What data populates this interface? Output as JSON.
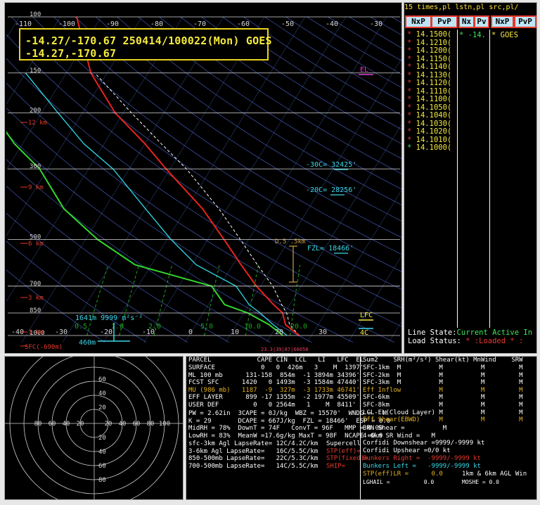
{
  "colors": {
    "temp": "#e8231e",
    "dewpoint": "#33d62d",
    "wetbulb": "#2ed8e8",
    "parcel": "#ffffff",
    "isobar": "#ffffff",
    "isotherm": "#4e6fc9",
    "mixratio": "#1aa41a",
    "dryadiabat": "#4459b8",
    "label_cyan": "#3ad8e8",
    "label_red": "#e23a2a",
    "label_yellow": "#f4ea3c",
    "label_magenta": "#e03ae0"
  },
  "location": {
    "line1": "-14.27/-170.67 250414/100022(Mon) GOES",
    "line2": "-14.27,-170.67"
  },
  "chart_data": {
    "type": "line",
    "title": "",
    "x_tick_labels_top": [
      "-110",
      "-100",
      "-90",
      "-80",
      "-70",
      "-60",
      "-50",
      "-40",
      "-30"
    ],
    "x_tick_labels_bottom": [
      "-40",
      "-30",
      "-20",
      "-10",
      "0",
      "10",
      "20",
      "30"
    ],
    "pressure_levels": [
      "100",
      "150",
      "200",
      "300",
      "500",
      "700",
      "850",
      "1000"
    ],
    "height_labels": [
      "12 km",
      "9 km",
      "6 km",
      "3 km",
      "1 km"
    ],
    "sfc_label": "SFC(-690m)",
    "mixing_ratio_labels": [
      "0.5",
      "1.0",
      "2.0",
      "5.0",
      "10.0",
      "20.0"
    ],
    "annotations": {
      "el": "EL",
      "m30c": "-30C= 32425'",
      "m20c": "-20C= 28256'",
      "fzl": "FZL= 18466'",
      "lfc": "LFC",
      "lcl": "4C",
      "storm": "1641m 9999 m²s⁻²",
      "hgt460": "460m",
      "ds": "D.5 .5km",
      "footer": "23.3|39|87|66058"
    },
    "temperature": {
      "pressure": [
        1000,
        925,
        850,
        800,
        700,
        600,
        500,
        400,
        300,
        250,
        200,
        150,
        100
      ],
      "value": [
        27,
        22,
        19.5,
        16,
        9,
        2,
        -6,
        -16,
        -31,
        -40,
        -52,
        -64,
        -76
      ]
    },
    "dewpoint": {
      "pressure": [
        1000,
        925,
        850,
        800,
        700,
        600,
        500,
        400,
        300,
        250,
        200,
        150,
        100
      ],
      "value": [
        23,
        18,
        11,
        4,
        -2,
        -24,
        -37,
        -50,
        -62,
        -72,
        -82,
        -90,
        -95
      ]
    },
    "wetbulb": {
      "pressure": [
        1000,
        925,
        850,
        800,
        700,
        600,
        500,
        400,
        300,
        250,
        200,
        150
      ],
      "value": [
        24,
        19,
        14,
        10,
        4,
        -9,
        -19,
        -30,
        -44,
        -55,
        -66,
        -80
      ]
    },
    "parcel": {
      "pressure": [
        1000,
        925,
        850,
        800,
        700,
        600,
        500,
        400,
        300,
        250,
        200,
        150
      ],
      "value": [
        27,
        23,
        20.5,
        18,
        13,
        6,
        -2,
        -12,
        -26,
        -36,
        -48,
        -63
      ]
    }
  },
  "right": {
    "header": "15 times,pl lstn,pl src,pl/",
    "cols": [
      "NxP",
      "PvP",
      "Nx",
      "Pv",
      "NxP",
      "PvP"
    ],
    "items": [
      "14.1500(",
      "14.1210(",
      "14.1200(",
      "14.1150(",
      "14.1140(",
      "14.1130(",
      "14.1120(",
      "14.1110(",
      "14.1100(",
      "14.1050(",
      "14.1040(",
      "14.1030(",
      "14.1020(",
      "14.1010(",
      "14.1000("
    ],
    "extra": "* -14.",
    "src": "* GOES",
    "line_state_label": "Line State:",
    "line_state_val": "Current Active In",
    "load_status_label": "Load Status:",
    "load_status_val": " * :Loaded * :"
  },
  "hodo": {
    "rings": [
      "20",
      "40",
      "60",
      "80"
    ],
    "left_labels": [
      "80",
      "60",
      "40",
      "20"
    ],
    "right_labels": [
      "20",
      "40",
      "60",
      "80",
      "100"
    ]
  },
  "table": {
    "parcel_head": "PARCEL            CAPE CIN  LCL   LI   LFC  EL",
    "parcels": [
      "SURFACE            0   0  426m   3    M  1397'",
      "ML 100 mb      131-158  854m  -1 3894m 34396'",
      "FCST SFC      1420   0 1493m  -3 1584m 47440'",
      "MU (986 mb)   1187  -9  327m  -3 1733m 46741'",
      "EFF LAYER      899 -17 1355m  -2 1977m 45509'",
      "USER DEF         0   0 2564m   1    M  8411'"
    ],
    "indices": [
      "PW = 2.62in  3CAPE = 0J/kg  WBZ = 15570'  WNDG =   M",
      "K = 29       DCAPE = 667J/kg  FZL = 18466'  ESP = 0.0",
      "MidRH = 78%  DownT = 74F   ConvT = 96F   MMP = 0.00",
      "LowRH = 83%  MeanW =17.6g/kg MaxT = 98F  NCAPE =0.0"
    ],
    "lapse": [
      "sfc-3km Agl LapseRate= 12C/4.2C/km",
      "3-6km Agl LapseRate=   16C/5.5C/km",
      "850-500mb LapseRate=   22C/5.3C/km",
      "700-500mb LapseRate=   14C/5.5C/km"
    ],
    "lapse_tags": [
      "Supercell",
      "STP(eff)=",
      "STP(fixed)=",
      "SHIP="
    ],
    "shear_head": "Sum2    SRH(m²/s²) Shear(kt) MnWind    SRW",
    "shear": [
      "SFC-1km  M          M          M         M",
      "SFC-2km  M          M          M         M",
      "SFC-3km  M          M          M         M",
      "Eff Inflow          M          M         M",
      "SFC-6km             M          M         M",
      "SFC-8km             M          M         M",
      "LCL-EL(Cloud Layer) M          M         M",
      "Eff Shear(EBWD)     M          M         M"
    ],
    "misc": [
      "BRN Shear =          M",
      "4-6km SR Wind =   M",
      "Corfidi Downshear =9999/-9999 kt",
      "Corfidi Upshear =0/0 kt"
    ],
    "bunkers_right": "Bunkers Right =  -9999/-9999 kt",
    "bunkers_left": "Bunkers Left =   -9999/-9999 kt",
    "stp_lr": "STP(eff)LR =      0.0",
    "stp_tail": "1km & 6km AGL Win",
    "lghail": "LGHAIL =          0.0",
    "moshe": "MOSHE = 0.0"
  }
}
